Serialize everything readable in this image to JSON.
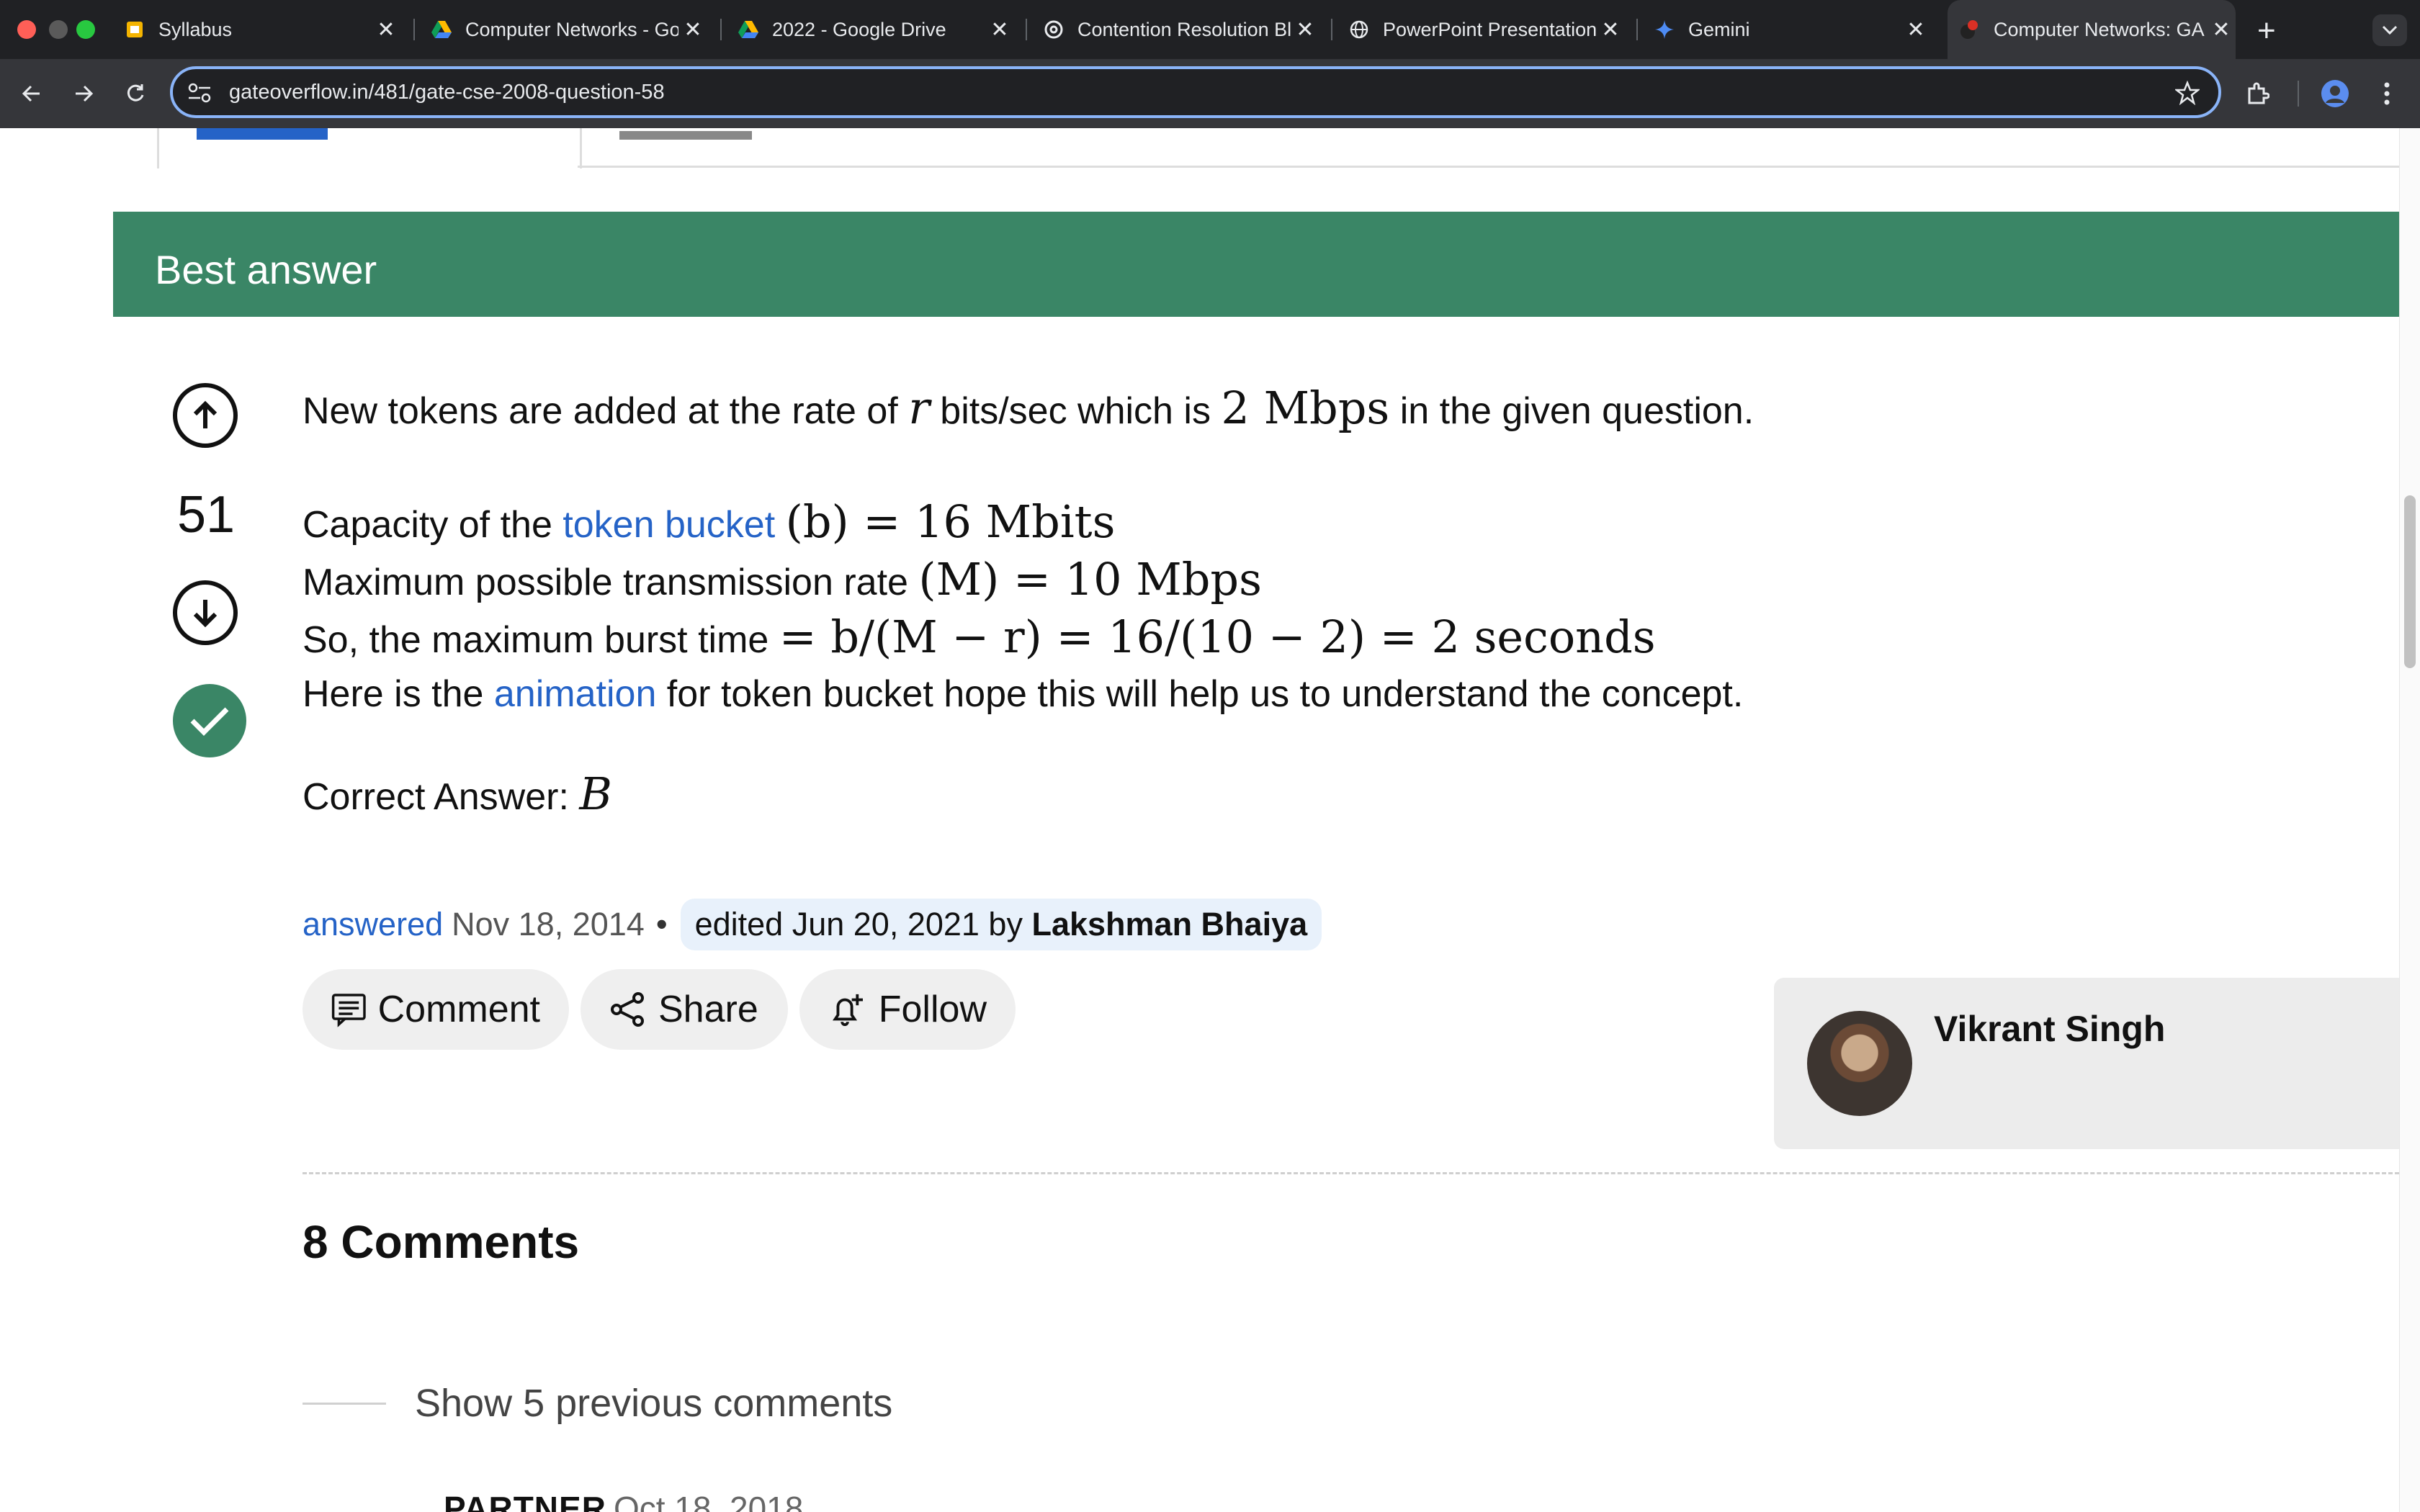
{
  "window": {
    "tabs": [
      {
        "label": "Syllabus",
        "icon": "google-slides-icon"
      },
      {
        "label": "Computer Networks - Go",
        "icon": "google-drive-icon"
      },
      {
        "label": "2022 - Google Drive",
        "icon": "google-drive-icon"
      },
      {
        "label": "Contention Resolution Bl",
        "icon": "openai-icon"
      },
      {
        "label": "PowerPoint Presentation",
        "icon": "globe-icon"
      },
      {
        "label": "Gemini",
        "icon": "gemini-icon"
      },
      {
        "label": "Computer Networks: GA",
        "icon": "gateoverflow-icon",
        "active": true
      }
    ],
    "new_tab_label": "+",
    "url": "gateoverflow.in/481/gate-cse-2008-question-58"
  },
  "answer": {
    "header": "Best answer",
    "votes": "51",
    "line1": {
      "pre": "New tokens are added at the rate of ",
      "var_r": "r",
      "mid": " bits/sec which is ",
      "math": "2 Mbps",
      "post": " in the given question."
    },
    "line2": {
      "pre": "Capacity of the ",
      "link": "token bucket",
      "math": "(b) = 16 Mbits"
    },
    "line3": {
      "pre": "Maximum possible transmission rate ",
      "math": "(M) = 10 Mbps"
    },
    "line4": {
      "pre": "So, the maximum burst time ",
      "math": "= b/(M − r) = 16/(10 − 2) = 2 seconds"
    },
    "line5": {
      "pre": "Here is the ",
      "link": "animation",
      "post": " for token bucket hope this will help us to understand the concept."
    },
    "correct": {
      "pre": "Correct Answer: ",
      "value": "B"
    },
    "meta": {
      "answered_label": "answered",
      "answered_date": "Nov 18, 2014",
      "sep": "•",
      "edited_pre": "edited Jun 20, 2021 by ",
      "editor": "Lakshman Bhaiya"
    },
    "actions": {
      "comment": "Comment",
      "share": "Share",
      "follow": "Follow"
    },
    "author": {
      "name": "Vikrant Singh"
    }
  },
  "comments": {
    "heading": "8 Comments",
    "show_previous": "Show 5 previous comments",
    "first": {
      "badge": "PARTNER",
      "date": "Oct 18, 2018"
    }
  },
  "colors": {
    "accent_green": "#3a8666",
    "link_blue": "#2563c7",
    "omnibox_focus": "#8ab4f8"
  }
}
